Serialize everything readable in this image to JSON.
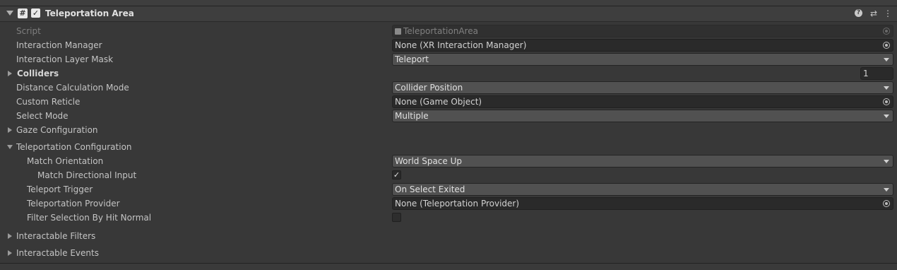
{
  "component": {
    "title": "Teleportation Area",
    "enabled": true,
    "header_icons": [
      "help-icon",
      "preset-icon",
      "kebab-menu-icon"
    ]
  },
  "fields": {
    "script": {
      "label": "Script",
      "value": "TeleportationArea"
    },
    "interaction_manager": {
      "label": "Interaction Manager",
      "value": "None (XR Interaction Manager)"
    },
    "interaction_layer_mask": {
      "label": "Interaction Layer Mask",
      "value": "Teleport"
    },
    "colliders": {
      "label": "Colliders",
      "count": "1"
    },
    "distance_calculation_mode": {
      "label": "Distance Calculation Mode",
      "value": "Collider Position"
    },
    "custom_reticle": {
      "label": "Custom Reticle",
      "value": "None (Game Object)"
    },
    "select_mode": {
      "label": "Select Mode",
      "value": "Multiple"
    },
    "gaze_configuration": {
      "label": "Gaze Configuration"
    },
    "teleportation_configuration": {
      "label": "Teleportation Configuration"
    },
    "match_orientation": {
      "label": "Match Orientation",
      "value": "World Space Up"
    },
    "match_directional_input": {
      "label": "Match Directional Input",
      "checked": true
    },
    "teleport_trigger": {
      "label": "Teleport Trigger",
      "value": "On Select Exited"
    },
    "teleportation_provider": {
      "label": "Teleportation Provider",
      "value": "None (Teleportation Provider)"
    },
    "filter_selection_by_hit_normal": {
      "label": "Filter Selection By Hit Normal",
      "checked": false
    },
    "interactable_filters": {
      "label": "Interactable Filters"
    },
    "interactable_events": {
      "label": "Interactable Events"
    }
  },
  "glyphs": {
    "script_icon": "#",
    "check": "✓",
    "help": "?",
    "preset": "⇄",
    "menu": "⋮"
  }
}
